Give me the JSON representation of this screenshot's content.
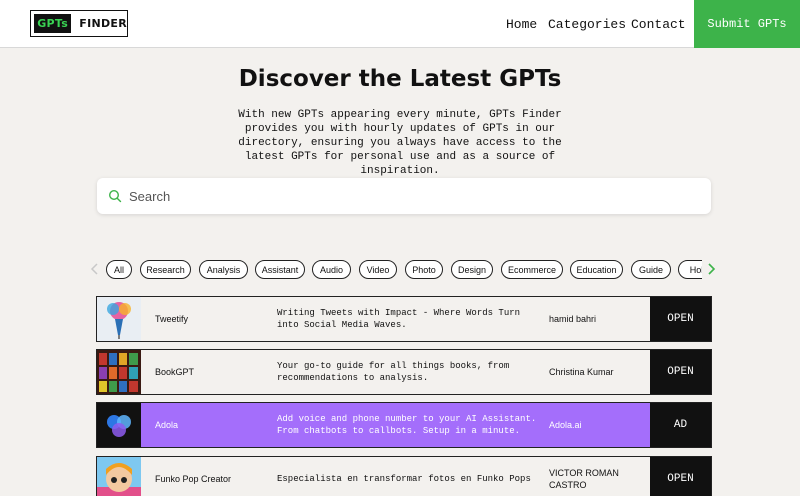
{
  "header": {
    "logo_left": "GPTs",
    "logo_right": "FINDER",
    "nav": {
      "home": "Home",
      "categories": "Categories",
      "contact": "Contact"
    },
    "submit_label": "Submit GPTs"
  },
  "hero": {
    "title": "Discover the Latest GPTs",
    "description": "With new GPTs appearing every minute, GPTs Finder provides you with hourly updates of GPTs in our directory, ensuring you always have access to the latest GPTs for personal use and as a source of inspiration."
  },
  "search": {
    "placeholder": "Search",
    "value": ""
  },
  "categories": [
    "All",
    "Research",
    "Analysis",
    "Assistant",
    "Audio",
    "Video",
    "Photo",
    "Design",
    "Ecommerce",
    "Education",
    "Guide",
    "Hob"
  ],
  "rows": [
    {
      "name": "Tweetify",
      "description": "Writing Tweets with Impact - Where Words Turn into Social Media Waves.",
      "author": "hamid bahri",
      "button": "OPEN"
    },
    {
      "name": "BookGPT",
      "description": "Your go-to guide for all things books, from recommendations to analysis.",
      "author": "Christina Kumar",
      "button": "OPEN"
    },
    {
      "name": "Adola",
      "description": "Add voice and phone number to your AI Assistant. From chatbots to callbots. Setup in a minute.",
      "author": "Adola.ai",
      "button": "AD"
    },
    {
      "name": "Funko Pop Creator",
      "description": "Especialista en transformar fotos en Funko Pops",
      "author": "VICTOR ROMAN CASTRO",
      "button": "OPEN"
    }
  ],
  "colors": {
    "accent_green": "#3db34a",
    "ad_purple": "#a46efb",
    "button_dark": "#111111"
  }
}
